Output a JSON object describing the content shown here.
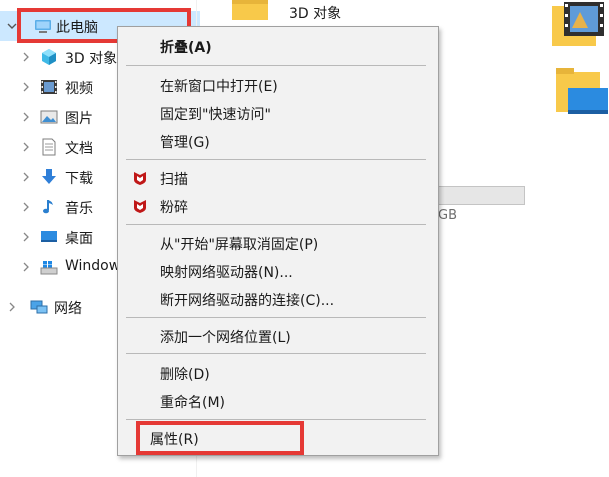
{
  "nav": {
    "root": {
      "label": "此电脑",
      "icon": "pc-icon",
      "expanded": true
    },
    "items": [
      {
        "label": "3D 对象",
        "icon": "3d-objects-icon"
      },
      {
        "label": "视频",
        "icon": "video-icon"
      },
      {
        "label": "图片",
        "icon": "pictures-icon"
      },
      {
        "label": "文档",
        "icon": "documents-icon"
      },
      {
        "label": "下载",
        "icon": "downloads-icon"
      },
      {
        "label": "音乐",
        "icon": "music-icon"
      },
      {
        "label": "桌面",
        "icon": "desktop-icon"
      },
      {
        "label": "Window",
        "icon": "windows-drive-icon"
      }
    ],
    "network": {
      "label": "网络",
      "icon": "network-icon"
    }
  },
  "content": {
    "folder_label": "3D 对象",
    "drive_size_fragment": "GB"
  },
  "context_menu": {
    "collapse": "折叠(A)",
    "open_new_window": "在新窗口中打开(E)",
    "pin_quick_access": "固定到\"快速访问\"",
    "manage": "管理(G)",
    "scan": "扫描",
    "shred": "粉碎",
    "unpin_start": "从\"开始\"屏幕取消固定(P)",
    "map_drive": "映射网络驱动器(N)...",
    "disconnect_drive": "断开网络驱动器的连接(C)...",
    "add_network_location": "添加一个网络位置(L)",
    "delete": "删除(D)",
    "rename": "重命名(M)",
    "properties": "属性(R)"
  },
  "colors": {
    "highlight_box": "#e53935",
    "selected_bg": "#cce8ff",
    "menu_bg": "#f2f2f2",
    "mcafee_red": "#c01818",
    "folder_yellow": "#f8c94a"
  }
}
